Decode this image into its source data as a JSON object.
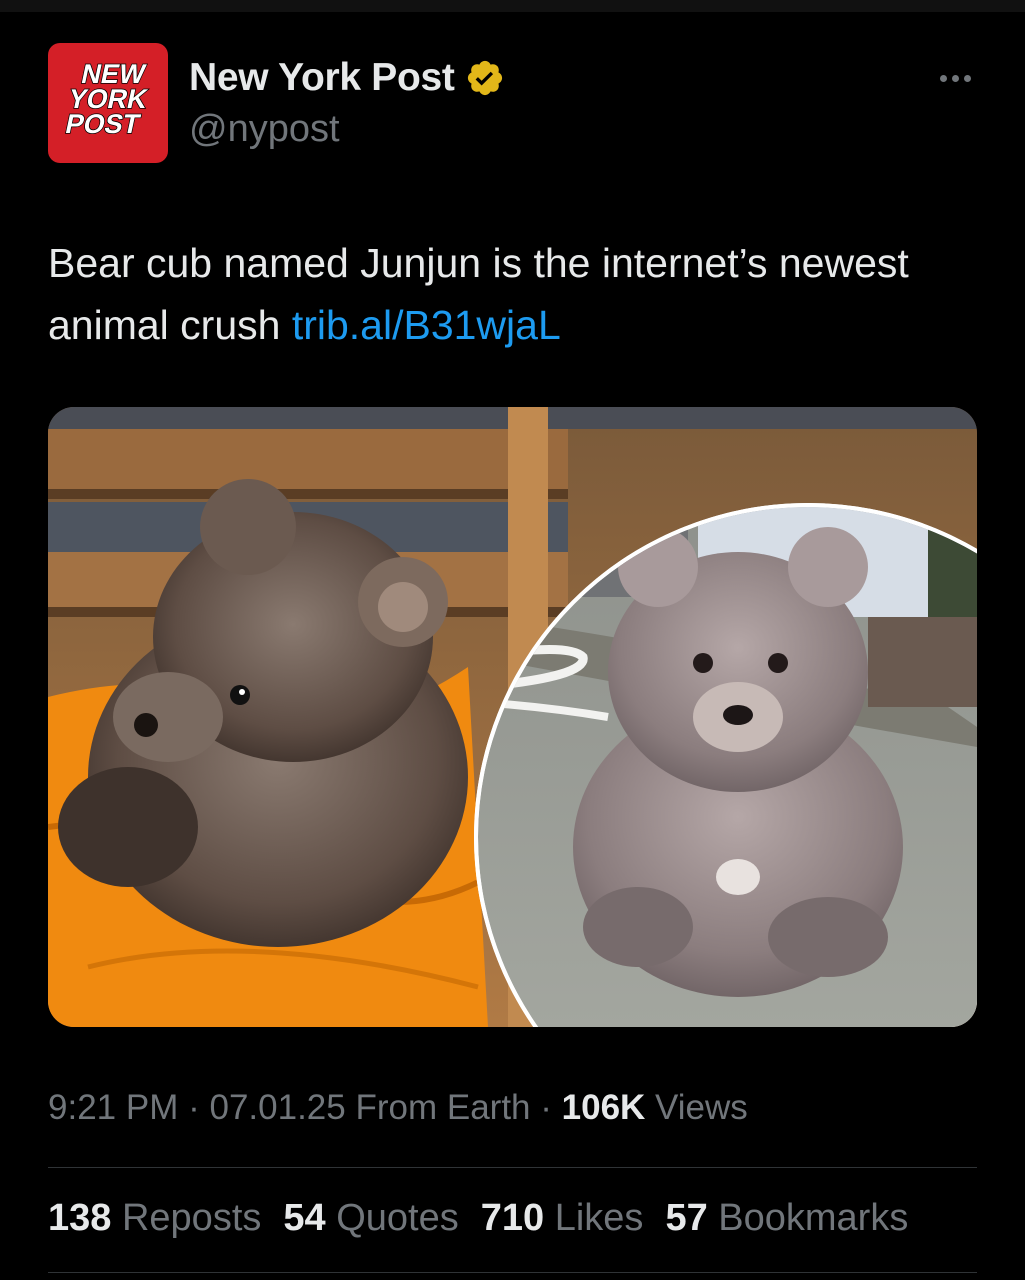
{
  "account": {
    "logo_lines": [
      "NEW",
      "YORK",
      "POST"
    ],
    "display_name": "New York Post",
    "handle": "@nypost",
    "verified": true,
    "verified_color": "#e2b719",
    "logo_color": "#d41f27"
  },
  "tweet": {
    "text": "Bear cub named Junjun is the internet’s newest animal crush ",
    "link_text": "trib.al/B31wjaL",
    "link_color": "#1d9bf0"
  },
  "meta": {
    "time": "9:21 PM",
    "date": "07.01.25",
    "location": "From Earth",
    "views_count": "106K",
    "views_label": "Views"
  },
  "stats": [
    {
      "count": "138",
      "label": "Reposts"
    },
    {
      "count": "54",
      "label": "Quotes"
    },
    {
      "count": "710",
      "label": "Likes"
    },
    {
      "count": "57",
      "label": "Bookmarks"
    }
  ],
  "icons": {
    "more": "more-horizontal-icon",
    "verified": "verified-badge-icon"
  }
}
